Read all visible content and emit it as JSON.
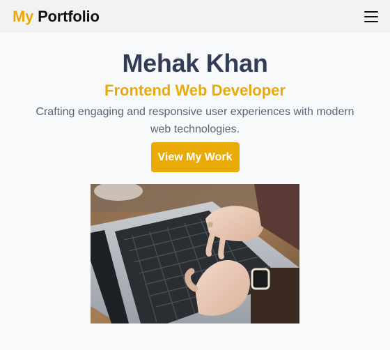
{
  "nav": {
    "brand_accent": "My",
    "brand_rest": " Portfolio",
    "menu_icon": "hamburger-menu-icon"
  },
  "hero": {
    "name": "Mehak Khan",
    "role": "Frontend Web Developer",
    "tagline": "Crafting engaging and responsive user experiences with modern web technologies.",
    "cta_label": "View My Work",
    "image_subject": "hands typing on a laptop keyboard"
  },
  "colors": {
    "accent": "#eaaa08",
    "heading": "#323d55",
    "body_text": "#5b6475",
    "nav_bg": "#f1f2f4",
    "page_bg": "#f8f9fb"
  }
}
